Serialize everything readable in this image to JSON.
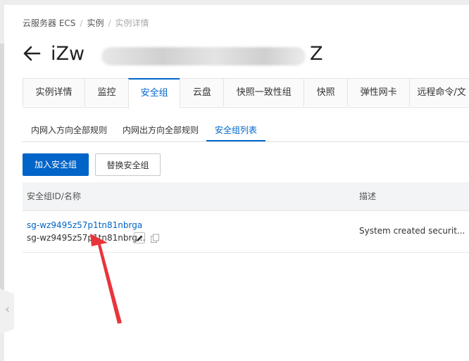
{
  "breadcrumb": {
    "items": [
      "云服务器 ECS",
      "实例",
      "实例详情"
    ]
  },
  "instance": {
    "title_start": "iZw",
    "title_end": "Z"
  },
  "tabs": [
    "实例详情",
    "监控",
    "安全组",
    "云盘",
    "快照一致性组",
    "快照",
    "弹性网卡",
    "远程命令/文"
  ],
  "active_tab": "安全组",
  "subtabs": [
    "内网入方向全部规则",
    "内网出方向全部规则",
    "安全组列表"
  ],
  "active_subtab": "安全组列表",
  "actions": {
    "add_label": "加入安全组",
    "replace_label": "替换安全组"
  },
  "table": {
    "headers": [
      "安全组ID/名称",
      "描述"
    ],
    "rows": [
      {
        "id": "sg-wz9495z57p1tn81nbrga",
        "name": "sg-wz9495z57p1tn81nbrg...",
        "description": "System created securit..."
      }
    ]
  },
  "icons": [
    "back-arrow-icon",
    "edit-icon",
    "copy-icon",
    "collapse-chevron-icon"
  ],
  "colors": {
    "accent": "#0064c8",
    "annotation_arrow": "#e8353b"
  }
}
